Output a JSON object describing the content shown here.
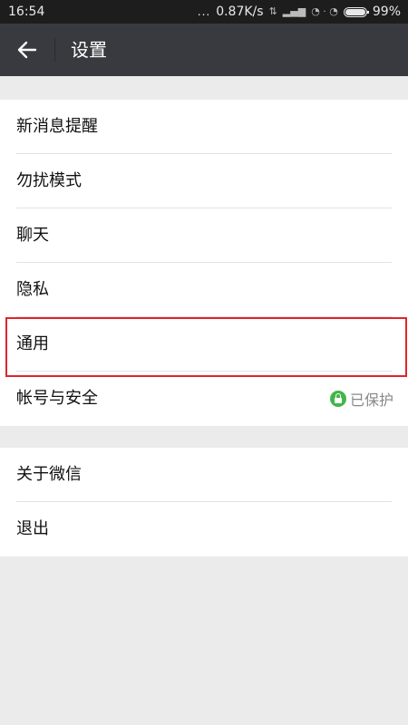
{
  "status_bar": {
    "time": "16:54",
    "dots": "...",
    "speed": "0.87K/s",
    "battery_percent": "99%",
    "icons": [
      "signal-icon",
      "network-icon",
      "alarm-icon",
      "battery-icon"
    ]
  },
  "nav": {
    "back_icon": "arrow-left-icon",
    "title": "设置"
  },
  "groups": [
    {
      "items": [
        {
          "label": "新消息提醒"
        },
        {
          "label": "勿扰模式"
        },
        {
          "label": "聊天"
        },
        {
          "label": "隐私"
        },
        {
          "label": "通用",
          "highlighted": true
        },
        {
          "label": "帐号与安全",
          "status": "已保护",
          "status_icon": "lock-icon",
          "status_color": "#44b549"
        }
      ]
    },
    {
      "items": [
        {
          "label": "关于微信"
        },
        {
          "label": "退出"
        }
      ]
    }
  ],
  "colors": {
    "nav_background": "#393a3f",
    "status_background": "#1d1d1d",
    "page_background": "#ebebeb",
    "highlight": "#e0242b"
  }
}
